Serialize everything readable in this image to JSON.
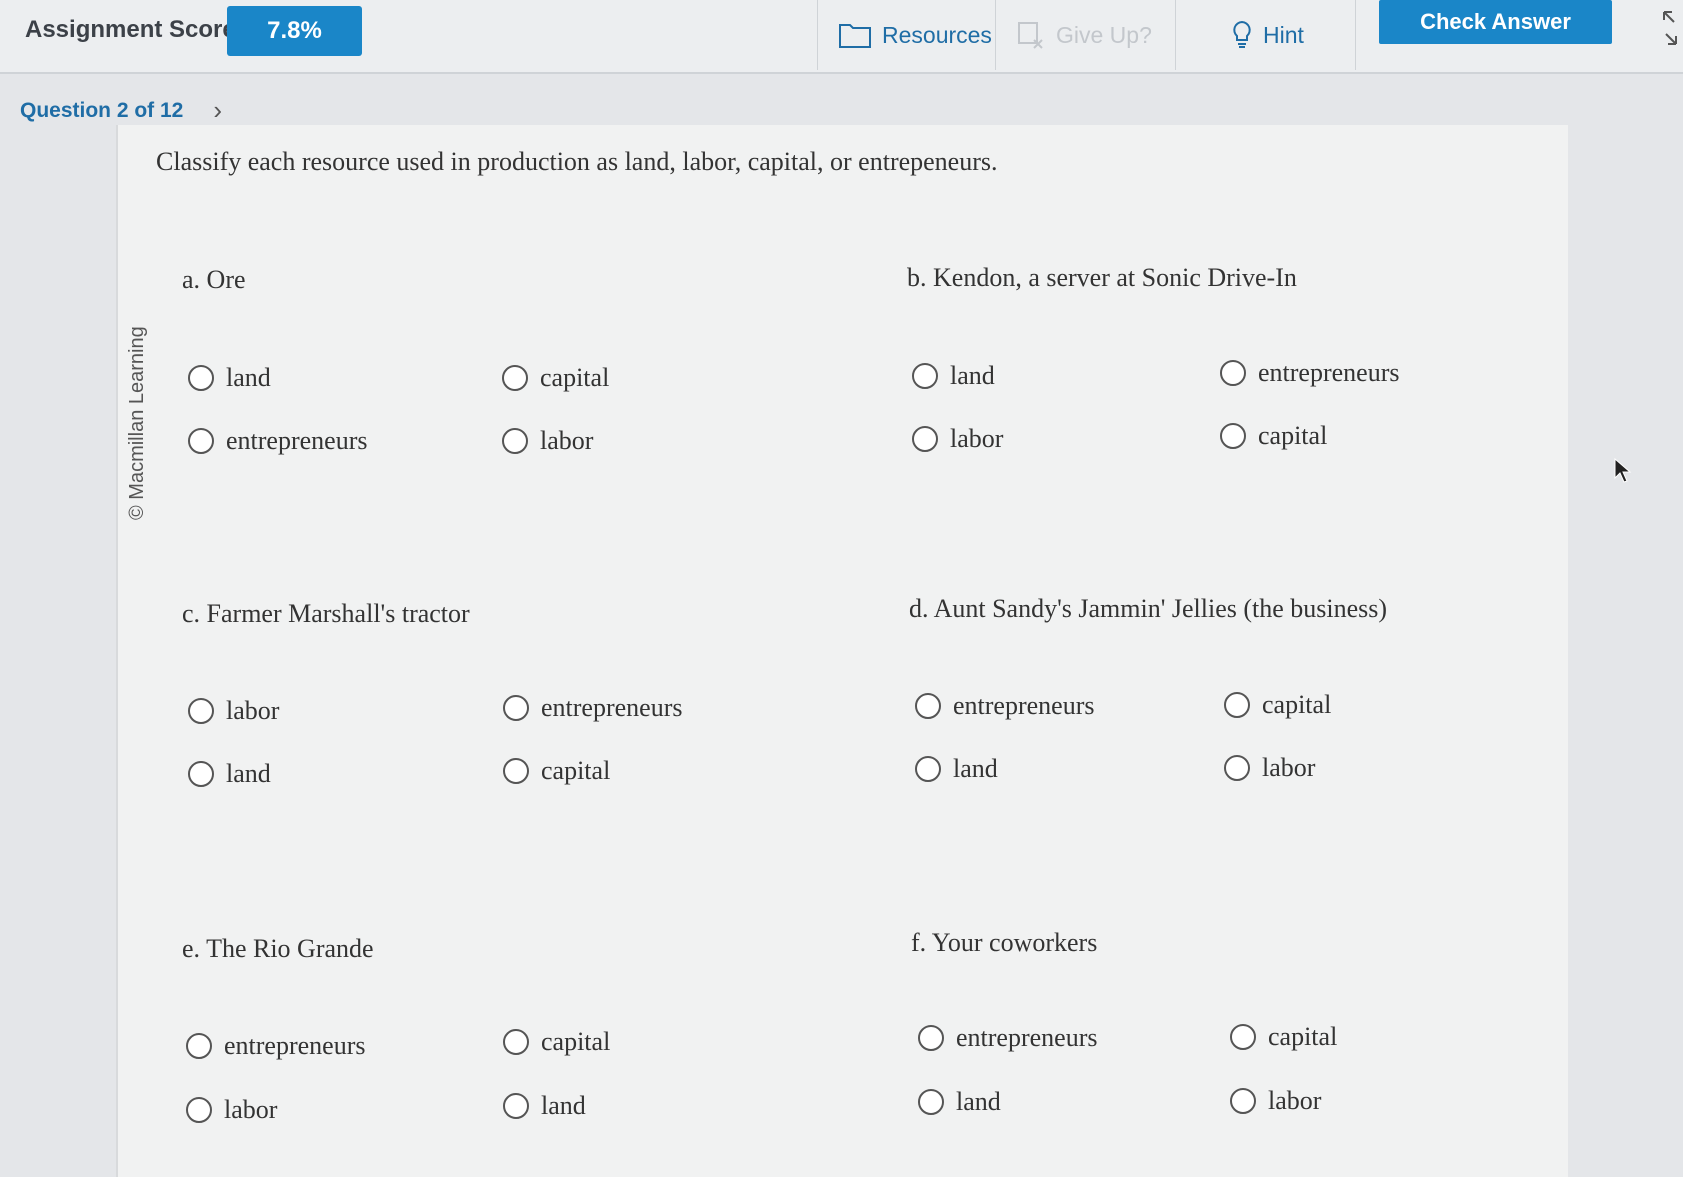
{
  "header": {
    "score_label": "Assignment Score:",
    "score_value": "7.8%",
    "resources_label": "Resources",
    "giveup_label": "Give Up?",
    "hint_label": "Hint",
    "check_label": "Check Answer"
  },
  "nav": {
    "question_label": "Question 2 of 12"
  },
  "panel": {
    "copyright": "© Macmillan Learning",
    "prompt": "Classify each resource used in production as land, labor, capital, or entrepeneurs."
  },
  "questions": [
    {
      "label": "a. Ore",
      "options": [
        "land",
        "capital",
        "entrepreneurs",
        "labor"
      ]
    },
    {
      "label": "b. Kendon, a server at Sonic Drive-In",
      "options": [
        "land",
        "entrepreneurs",
        "labor",
        "capital"
      ]
    },
    {
      "label": "c. Farmer Marshall's tractor",
      "options": [
        "labor",
        "entrepreneurs",
        "land",
        "capital"
      ]
    },
    {
      "label": "d. Aunt Sandy's Jammin' Jellies (the business)",
      "options": [
        "entrepreneurs",
        "capital",
        "land",
        "labor"
      ]
    },
    {
      "label": "e. The Rio Grande",
      "options": [
        "entrepreneurs",
        "capital",
        "labor",
        "land"
      ]
    },
    {
      "label": "f. Your coworkers",
      "options": [
        "entrepreneurs",
        "capital",
        "land",
        "labor"
      ]
    }
  ],
  "colors": {
    "accent": "#1a86c8",
    "link": "#1f6da6"
  }
}
